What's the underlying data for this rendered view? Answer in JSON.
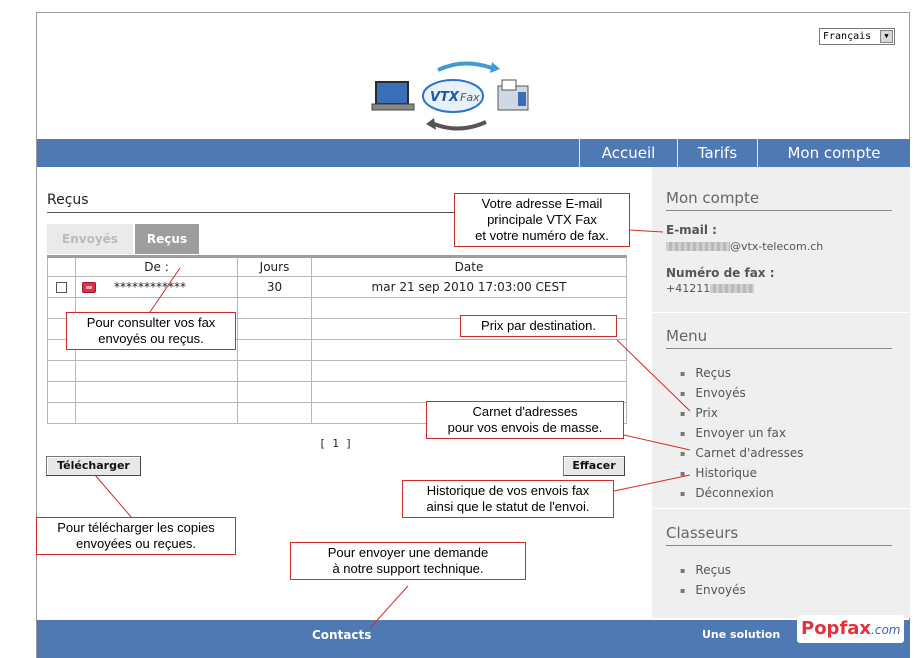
{
  "language": {
    "selected": "Français"
  },
  "logo": {
    "text": "VTX",
    "subtext": "Fax"
  },
  "nav": {
    "items": [
      "Accueil",
      "Tarifs",
      "Mon compte"
    ]
  },
  "main": {
    "title": "Reçus",
    "tabs": [
      {
        "label": "Envoyés",
        "active": false
      },
      {
        "label": "Reçus",
        "active": true
      }
    ],
    "table": {
      "headers": [
        "",
        "De :",
        "Jours",
        "Date"
      ],
      "rows": [
        {
          "from": "************",
          "days": "30",
          "date": "mar 21 sep 2010 17:03:00 CEST"
        }
      ]
    },
    "pager": "[ 1 ]",
    "download_button": "Télécharger",
    "delete_button": "Effacer"
  },
  "sidebar": {
    "account_title": "Mon compte",
    "email_label": "E-mail :",
    "email_value_suffix": "@vtx-telecom.ch",
    "fax_label": "Numéro de fax :",
    "fax_value_prefix": "+41211",
    "menu_title": "Menu",
    "menu_items": [
      "Reçus",
      "Envoyés",
      "Prix",
      "Envoyer un fax",
      "Carnet d'adresses",
      "Historique",
      "Déconnexion"
    ],
    "folders_title": "Classeurs",
    "folder_items": [
      "Reçus",
      "Envoyés"
    ]
  },
  "footer": {
    "contacts": "Contacts",
    "solution": "Une solution",
    "brand": "Popfax",
    "brand_suffix": ".com"
  },
  "callouts": {
    "email": [
      "Votre adresse E-mail",
      "principale VTX Fax",
      "et votre numéro de fax."
    ],
    "tabs": [
      "Pour consulter vos fax",
      "envoyés ou reçus."
    ],
    "prices": [
      "Prix par destination."
    ],
    "addressbook": [
      "Carnet d'adresses",
      "pour vos envois de masse."
    ],
    "history": [
      "Historique de vos envois fax",
      "ainsi que le statut de l'envoi."
    ],
    "download": [
      "Pour télécharger les copies",
      "envoyées ou reçues."
    ],
    "support": [
      "Pour envoyer une demande",
      "à notre support technique."
    ]
  },
  "colors": {
    "nav": "#4e79b3",
    "callout_border": "#d22a2a",
    "sidebar": "#efefef"
  }
}
